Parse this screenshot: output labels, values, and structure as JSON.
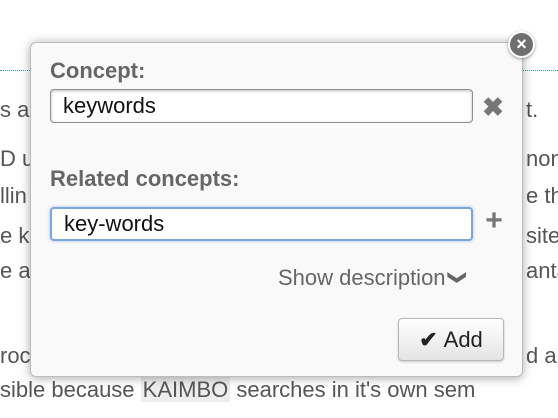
{
  "background": {
    "lines": [
      {
        "left": "s a",
        "right": "t."
      },
      {
        "left": "D u",
        "right": "non"
      },
      {
        "left": "llin",
        "right": "e th"
      },
      {
        "left": "e k",
        "right": "site"
      },
      {
        "left": "e a",
        "right": "anta"
      },
      {
        "left": "roc",
        "right": "d an"
      },
      {
        "left": "sible because ",
        "highlight": "KAIMBO",
        "rest": " searches in it's own sem"
      }
    ]
  },
  "popup": {
    "close_glyph": "×",
    "concept_label": "Concept:",
    "concept_value": "keywords",
    "concept_clear_glyph": "✖",
    "related_label": "Related concepts:",
    "related_value": "key-words",
    "related_add_glyph": "+",
    "show_description": "Show description",
    "show_description_chevron": "❯",
    "add_check_glyph": "✔",
    "add_label": "Add"
  },
  "colors": {
    "accent_focus": "#7aa7db",
    "divider": "#2aa3b3"
  }
}
